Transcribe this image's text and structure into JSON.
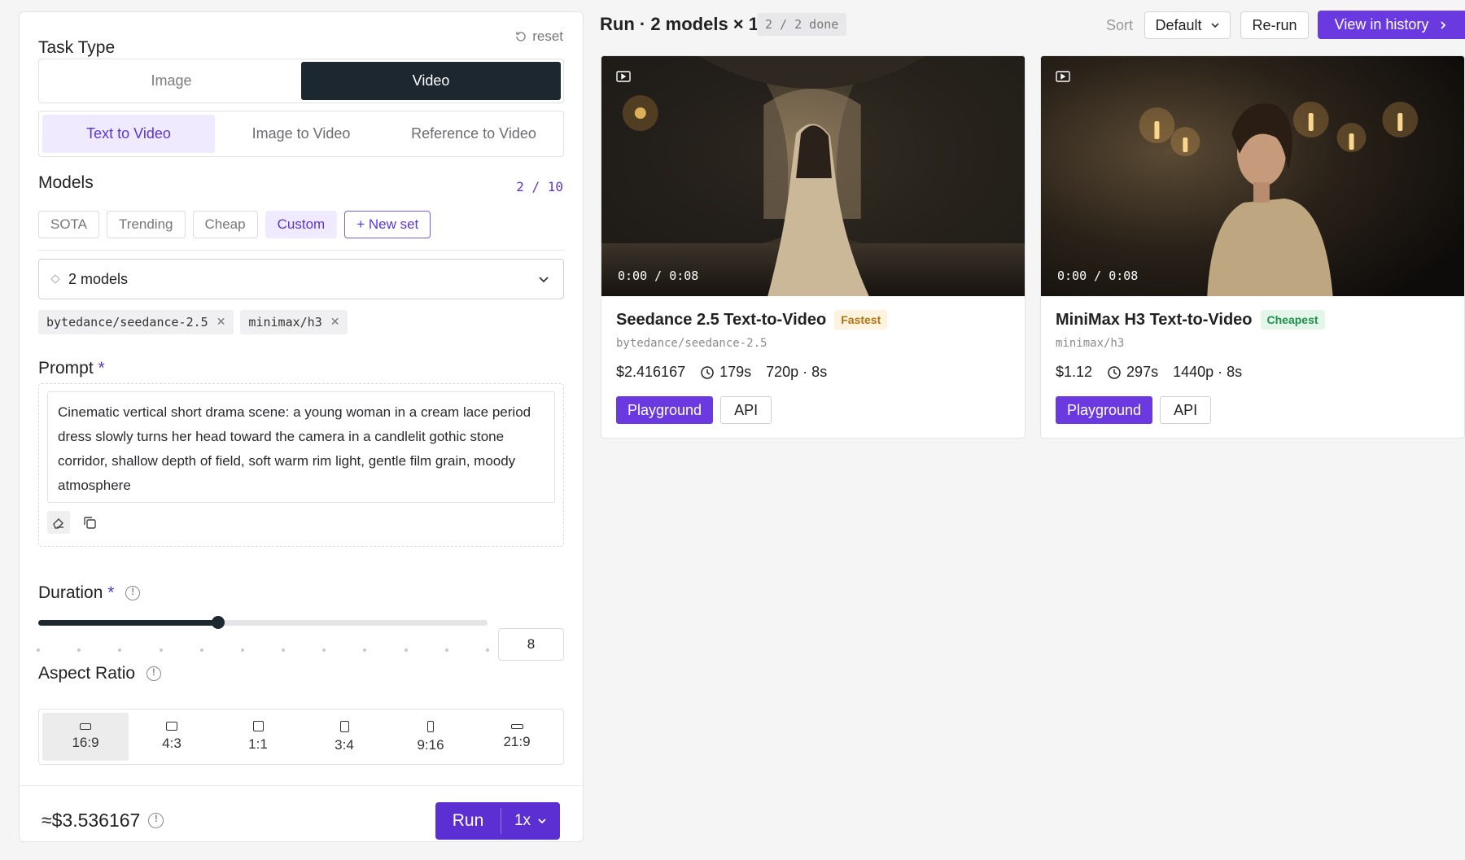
{
  "task_type": {
    "title": "Task Type",
    "reset_label": "reset",
    "types": [
      "Image",
      "Video"
    ],
    "active_type": "Video",
    "modes": [
      "Text to Video",
      "Image to Video",
      "Reference to Video"
    ],
    "active_mode": "Text to Video"
  },
  "models": {
    "title": "Models",
    "count": "2 / 10",
    "presets": [
      "SOTA",
      "Trending",
      "Cheap",
      "Custom"
    ],
    "active_preset": "Custom",
    "new_set_label": "+ New set",
    "select_value": "2 models",
    "selected": [
      "bytedance/seedance-2.5",
      "minimax/h3"
    ]
  },
  "prompt": {
    "title": "Prompt",
    "required_mark": "*",
    "text": "Cinematic vertical short drama scene: a young woman in a cream lace period dress slowly turns her head toward the camera in a candlelit gothic stone corridor, shallow depth of field, soft warm rim light, gentle film grain, moody atmosphere"
  },
  "duration": {
    "title": "Duration",
    "required_mark": "*",
    "value": "8",
    "level": 0.4,
    "ticks": 12
  },
  "aspect_ratio": {
    "title": "Aspect Ratio",
    "options": [
      "16:9",
      "4:3",
      "1:1",
      "3:4",
      "9:16",
      "21:9"
    ],
    "active": "16:9"
  },
  "footer": {
    "cost": "≈$3.536167",
    "run_label": "Run",
    "multiplier": "1x"
  },
  "run_header": {
    "title": "Run · 2 models × 1",
    "status": "2 / 2 done",
    "sort_label": "Sort",
    "sort_value": "Default",
    "rerun_label": "Re-run",
    "history_label": "View in history"
  },
  "results": [
    {
      "title": "Seedance 2.5 Text-to-Video",
      "badge": "Fastest",
      "slug": "bytedance/seedance-2.5",
      "price": "$2.416167",
      "gen_time": "179s",
      "spec": "720p · 8s",
      "time": "0:00 / 0:08",
      "playground_label": "Playground",
      "api_label": "API"
    },
    {
      "title": "MiniMax H3 Text-to-Video",
      "badge": "Cheapest",
      "slug": "minimax/h3",
      "price": "$1.12",
      "gen_time": "297s",
      "spec": "1440p · 8s",
      "time": "0:00 / 0:08",
      "playground_label": "Playground",
      "api_label": "API"
    }
  ],
  "colors": {
    "accent": "#6a3ae0",
    "dark": "#1d2730",
    "accent_soft": "#efeafd"
  }
}
